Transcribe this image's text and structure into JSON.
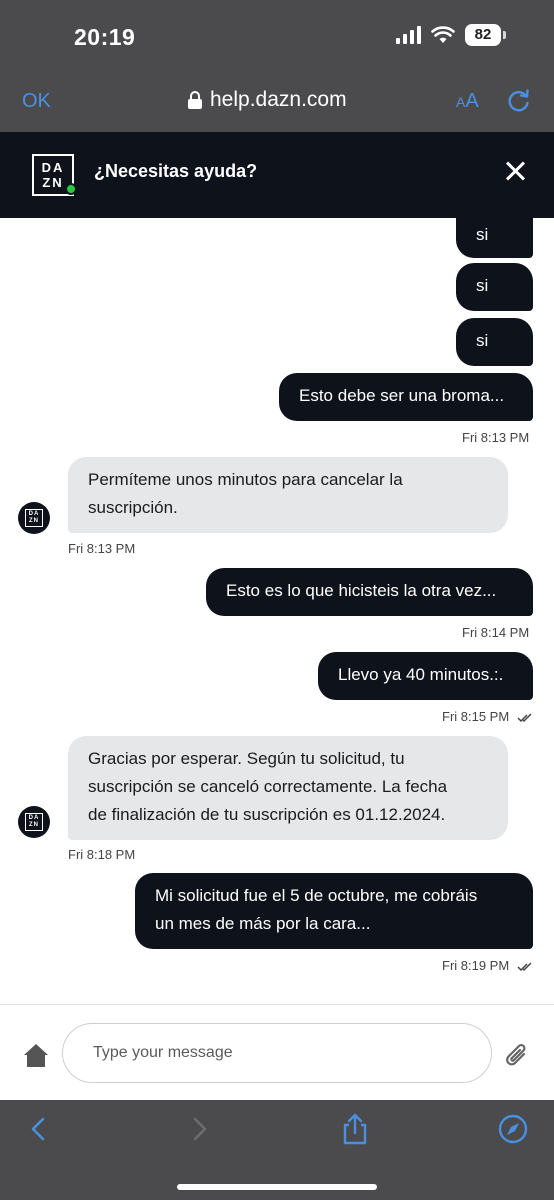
{
  "status": {
    "time": "20:19",
    "battery": "82"
  },
  "browser": {
    "done_label": "OK",
    "url": "help.dazn.com",
    "text_size_label": "AA"
  },
  "header": {
    "logo_top": "DA",
    "logo_bottom": "ZN",
    "title": "¿Necesitas ayuda?"
  },
  "messages": [
    {
      "from": "user",
      "text": "si"
    },
    {
      "from": "user",
      "text": "si"
    },
    {
      "from": "user",
      "text": "si"
    },
    {
      "from": "user",
      "text": "Esto debe ser una broma...",
      "time": "Fri 8:13 PM"
    },
    {
      "from": "agent",
      "line1": "Permíteme unos minutos para cancelar la",
      "line2": "suscripción.",
      "time": "Fri 8:13 PM"
    },
    {
      "from": "user",
      "text": "Esto es lo que hicisteis la otra vez...",
      "time": "Fri 8:14 PM"
    },
    {
      "from": "user",
      "text": "Llevo ya 40 minutos.:.",
      "time": "Fri 8:15 PM"
    },
    {
      "from": "agent",
      "line1": "Gracias por esperar. Según tu solicitud, tu",
      "line2": "suscripción se canceló correctamente. La fecha",
      "line3": "de finalización de tu suscripción es 01.12.2024.",
      "time": "Fri 8:18 PM"
    },
    {
      "from": "user",
      "line1": "Mi solicitud fue el 5 de octubre, me cobráis",
      "line2": "un mes de más por la cara...",
      "time": "Fri 8:19 PM"
    }
  ],
  "composer": {
    "placeholder": "Type your message"
  },
  "icons": {
    "home": "home-icon",
    "attach": "paperclip-icon",
    "back": "chevron-left-icon",
    "forward": "chevron-right-icon",
    "share": "share-icon",
    "compass": "compass-icon",
    "close": "close-icon",
    "lock": "lock-icon",
    "reload": "reload-icon"
  },
  "colors": {
    "accent": "#4a90e2",
    "bubble_user": "#0d121b",
    "bubble_agent": "#e6e7e9",
    "online": "#28c840"
  }
}
